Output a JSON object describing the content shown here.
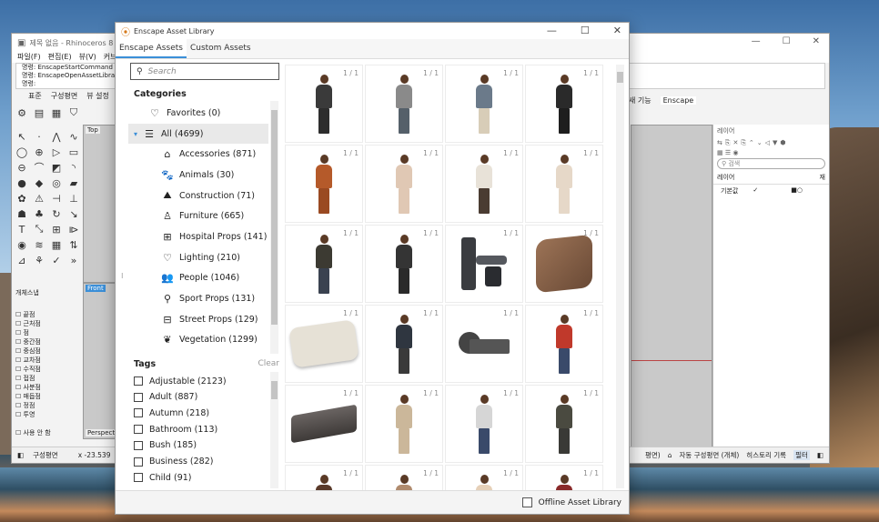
{
  "rhino": {
    "title": "제목 없음 - Rhinoceros 8 Co",
    "menu": [
      "파일(F)",
      "편집(E)",
      "뷰(V)",
      "커브"
    ],
    "commands": [
      "명령: EnscapeStartCommand",
      "명령: EnscapeOpenAssetLibrar",
      "명령:"
    ],
    "tabs": [
      "표준",
      "구성평면",
      "뷰 설정"
    ],
    "right_tabs": [
      "새 기능",
      "Enscape"
    ],
    "viewport_top": "Top",
    "viewport_front": "Front",
    "viewport_perspective": "Perspect",
    "osnap_title": "개체스냅",
    "osnaps": [
      "끝점",
      "근처점",
      "점",
      "중간점",
      "중심점",
      "교차점",
      "수직점",
      "접점",
      "사분점",
      "매듭점",
      "정점",
      "투영"
    ],
    "disable_label": "사용 안 함",
    "layer_panel_title": "레이어",
    "layer_search_placeholder": "검색",
    "layer_col": "레이어",
    "layer_col_short": "재",
    "layer_default": "기본값",
    "status_left": "구성평면",
    "status_coord": "x -23.539",
    "status_right_items": [
      "평면)",
      "자동 구성평면 (개체)",
      "히스토리 기록",
      "필터"
    ]
  },
  "dialog": {
    "title": "Enscape Asset Library",
    "tabs": [
      "Enscape Assets",
      "Custom Assets"
    ],
    "search_placeholder": "Search",
    "categories_title": "Categories",
    "favorites": "Favorites (0)",
    "all": "All (4699)",
    "categories": [
      {
        "label": "Accessories (871)",
        "icon": "accessories-icon",
        "glyph": "⌂"
      },
      {
        "label": "Animals (30)",
        "icon": "paw-icon",
        "glyph": "🐾"
      },
      {
        "label": "Construction (71)",
        "icon": "construction-icon",
        "glyph": "⛰"
      },
      {
        "label": "Furniture (665)",
        "icon": "chair-icon",
        "glyph": "♙"
      },
      {
        "label": "Hospital Props (141)",
        "icon": "hospital-icon",
        "glyph": "⊞"
      },
      {
        "label": "Lighting (210)",
        "icon": "bulb-icon",
        "glyph": "♡"
      },
      {
        "label": "People (1046)",
        "icon": "people-icon",
        "glyph": "👥"
      },
      {
        "label": "Sport Props (131)",
        "icon": "sport-icon",
        "glyph": "⚲"
      },
      {
        "label": "Street Props (129)",
        "icon": "street-icon",
        "glyph": "⊟"
      },
      {
        "label": "Vegetation (1299)",
        "icon": "vegetation-icon",
        "glyph": "❦"
      }
    ],
    "tags_title": "Tags",
    "clear_label": "Clear",
    "tags": [
      "Adjustable (2123)",
      "Adult (887)",
      "Autumn (218)",
      "Bathroom (113)",
      "Bush (185)",
      "Business (282)",
      "Child (91)"
    ],
    "offline_label": "Offline Asset Library",
    "asset_count": "1 / 1",
    "assets": [
      {
        "kind": "person",
        "top": "#3a3a3a",
        "bottom": "#2d2d2d"
      },
      {
        "kind": "person",
        "top": "#8a8a8a",
        "bottom": "#55606a"
      },
      {
        "kind": "person",
        "top": "#6b7a8a",
        "bottom": "#d8cdb8"
      },
      {
        "kind": "person",
        "top": "#2a2a2a",
        "bottom": "#1e1e1e"
      },
      {
        "kind": "person",
        "top": "#b55a2a",
        "bottom": "#9a4a22"
      },
      {
        "kind": "person",
        "top": "#e0c8b4",
        "bottom": "#e0c8b4"
      },
      {
        "kind": "person",
        "top": "#e8e2d8",
        "bottom": "#4a3c32"
      },
      {
        "kind": "person",
        "top": "#e6d8c8",
        "bottom": "#e6d8c8"
      },
      {
        "kind": "person",
        "top": "#3c3a32",
        "bottom": "#3a4250"
      },
      {
        "kind": "person",
        "top": "#343434",
        "bottom": "#2a2a2a"
      },
      {
        "kind": "machine"
      },
      {
        "kind": "cube"
      },
      {
        "kind": "pillow"
      },
      {
        "kind": "person",
        "top": "#2f3640",
        "bottom": "#3a3a3a"
      },
      {
        "kind": "roll"
      },
      {
        "kind": "person",
        "top": "#c0392b",
        "bottom": "#3a4a6a"
      },
      {
        "kind": "step"
      },
      {
        "kind": "person",
        "top": "#cbb79a",
        "bottom": "#cbb79a"
      },
      {
        "kind": "person",
        "top": "#d6d6d6",
        "bottom": "#3a4a6a"
      },
      {
        "kind": "person",
        "top": "#4a4a40",
        "bottom": "#3a3a36"
      },
      {
        "kind": "person",
        "top": "#5a3a2a",
        "bottom": "#5a3a2a"
      },
      {
        "kind": "person",
        "top": "#b08b6e",
        "bottom": "#b08b6e"
      },
      {
        "kind": "person",
        "top": "#e6d0b8",
        "bottom": "#e6d0b8"
      },
      {
        "kind": "person",
        "top": "#8a2a2a",
        "bottom": "#8a2a2a"
      }
    ]
  }
}
